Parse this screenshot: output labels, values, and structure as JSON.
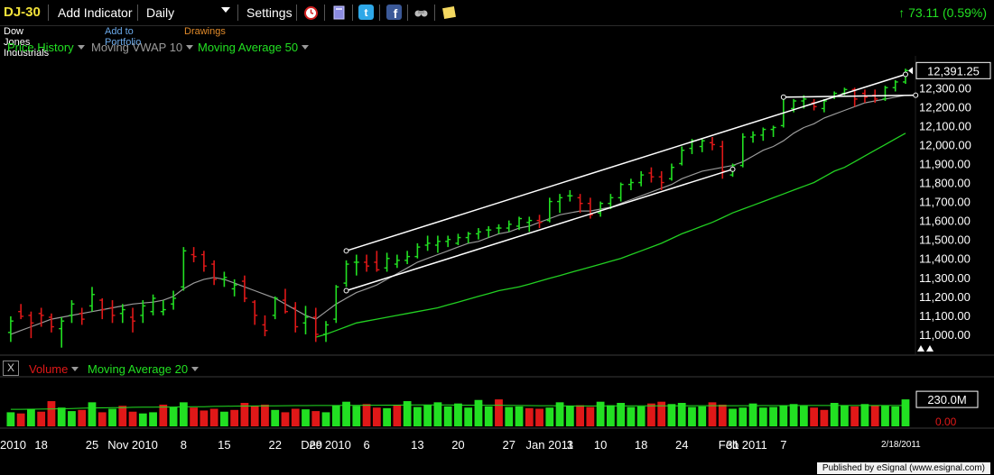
{
  "toolbar": {
    "symbol": "DJ-30",
    "add_indicator": "Add Indicator",
    "timeframe": "Daily",
    "settings": "Settings",
    "change": "73.11 (0.59%)",
    "icons": [
      "alarm-clock-icon",
      "book-icon",
      "twitter-icon",
      "facebook-icon",
      "binoculars-icon",
      "note-icon"
    ]
  },
  "links": {
    "name": "Dow Jones Industrials",
    "portfolio": "Add to Portfolio",
    "drawings": "Drawings"
  },
  "studies": {
    "price_history": "Price History",
    "vwap": "Moving VWAP 10",
    "ma50": "Moving Average 50"
  },
  "volume_pane": {
    "close_label": "X",
    "volume": "Volume",
    "ma20": "Moving Average 20",
    "last_value": "230.0M",
    "zero_label": "0.00"
  },
  "last_price": "12,391.25",
  "date_stamp": "2/18/2011",
  "footer": "Published by eSignal (www.esignal.com)",
  "colors": {
    "up": "#22e022",
    "down": "#e01818",
    "vwap": "#9a9a9a",
    "ma50": "#22d022",
    "background": "#000000"
  },
  "chart_data": {
    "type": "bar",
    "ylim": [
      10900,
      12420
    ],
    "yticks": [
      "12,300.00",
      "12,200.00",
      "12,100.00",
      "12,000.00",
      "11,900.00",
      "11,800.00",
      "11,700.00",
      "11,600.00",
      "11,500.00",
      "11,400.00",
      "11,300.00",
      "11,200.00",
      "11,100.00",
      "11,000.00"
    ],
    "ytick_values": [
      12300,
      12200,
      12100,
      12000,
      11900,
      11800,
      11700,
      11600,
      11500,
      11400,
      11300,
      11200,
      11100,
      11000
    ],
    "x_labels": [
      "2010",
      "18",
      "25",
      "Nov 2010",
      "8",
      "15",
      "22",
      "29",
      "Dec 2010",
      "6",
      "13",
      "20",
      "27",
      "Jan 2011",
      "3",
      "10",
      "18",
      "24",
      "31",
      "Feb 2011",
      "7"
    ],
    "x_label_index": [
      -1,
      3,
      8,
      12,
      17,
      21,
      26,
      30,
      31,
      35,
      40,
      44,
      49,
      53,
      53,
      58,
      62,
      66,
      71,
      72,
      76
    ],
    "ohlc": [
      [
        11010,
        11095,
        10960,
        11070
      ],
      [
        11120,
        11160,
        11080,
        11095
      ],
      [
        11100,
        11120,
        10980,
        11060
      ],
      [
        11110,
        11140,
        11040,
        11100
      ],
      [
        11090,
        11110,
        11010,
        11040
      ],
      [
        11030,
        11090,
        10930,
        11070
      ],
      [
        11100,
        11180,
        11060,
        11160
      ],
      [
        11110,
        11140,
        11050,
        11080
      ],
      [
        11150,
        11250,
        11120,
        11210
      ],
      [
        11180,
        11190,
        11080,
        11130
      ],
      [
        11140,
        11180,
        11060,
        11100
      ],
      [
        11110,
        11160,
        11060,
        11130
      ],
      [
        11090,
        11140,
        11010,
        11070
      ],
      [
        11100,
        11180,
        11060,
        11150
      ],
      [
        11120,
        11210,
        11100,
        11190
      ],
      [
        11120,
        11180,
        11100,
        11130
      ],
      [
        11160,
        11230,
        11130,
        11190
      ],
      [
        11250,
        11460,
        11230,
        11440
      ],
      [
        11420,
        11460,
        11380,
        11410
      ],
      [
        11420,
        11440,
        11330,
        11360
      ],
      [
        11370,
        11390,
        11260,
        11290
      ],
      [
        11290,
        11330,
        11250,
        11300
      ],
      [
        11240,
        11290,
        11200,
        11260
      ],
      [
        11280,
        11310,
        11170,
        11190
      ],
      [
        11170,
        11180,
        11050,
        11100
      ],
      [
        11050,
        11100,
        10990,
        11020
      ],
      [
        11100,
        11200,
        11080,
        11190
      ],
      [
        11180,
        11240,
        11110,
        11120
      ],
      [
        11140,
        11170,
        11010,
        11040
      ],
      [
        11060,
        11150,
        11000,
        11090
      ],
      [
        11090,
        11140,
        10960,
        11000
      ],
      [
        11000,
        11070,
        10960,
        11050
      ],
      [
        11080,
        11260,
        11060,
        11250
      ],
      [
        11270,
        11390,
        11250,
        11370
      ],
      [
        11380,
        11420,
        11310,
        11380
      ],
      [
        11380,
        11420,
        11330,
        11360
      ],
      [
        11380,
        11440,
        11330,
        11340
      ],
      [
        11350,
        11430,
        11330,
        11400
      ],
      [
        11370,
        11420,
        11350,
        11390
      ],
      [
        11390,
        11440,
        11370,
        11410
      ],
      [
        11410,
        11480,
        11400,
        11460
      ],
      [
        11470,
        11520,
        11440,
        11480
      ],
      [
        11470,
        11520,
        11430,
        11490
      ],
      [
        11490,
        11520,
        11460,
        11500
      ],
      [
        11480,
        11530,
        11470,
        11510
      ],
      [
        11510,
        11540,
        11480,
        11530
      ],
      [
        11530,
        11560,
        11500,
        11540
      ],
      [
        11550,
        11570,
        11510,
        11550
      ],
      [
        11560,
        11580,
        11530,
        11560
      ],
      [
        11560,
        11600,
        11540,
        11580
      ],
      [
        11570,
        11620,
        11550,
        11610
      ],
      [
        11590,
        11620,
        11540,
        11600
      ],
      [
        11600,
        11630,
        11560,
        11590
      ],
      [
        11600,
        11720,
        11590,
        11700
      ],
      [
        11700,
        11740,
        11640,
        11720
      ],
      [
        11730,
        11760,
        11700,
        11730
      ],
      [
        11720,
        11740,
        11640,
        11690
      ],
      [
        11690,
        11720,
        11610,
        11630
      ],
      [
        11640,
        11700,
        11620,
        11690
      ],
      [
        11690,
        11740,
        11660,
        11720
      ],
      [
        11720,
        11800,
        11700,
        11790
      ],
      [
        11790,
        11820,
        11760,
        11800
      ],
      [
        11800,
        11860,
        11780,
        11840
      ],
      [
        11850,
        11880,
        11800,
        11830
      ],
      [
        11830,
        11860,
        11760,
        11800
      ],
      [
        11820,
        11900,
        11810,
        11880
      ],
      [
        11900,
        11990,
        11890,
        11970
      ],
      [
        11980,
        12030,
        11950,
        12020
      ],
      [
        11990,
        12030,
        11960,
        12020
      ],
      [
        12010,
        12040,
        11970,
        12000
      ],
      [
        11990,
        12020,
        11820,
        11860
      ],
      [
        11840,
        11900,
        11830,
        11890
      ],
      [
        11890,
        12060,
        11880,
        12040
      ],
      [
        12040,
        12070,
        12010,
        12050
      ],
      [
        12050,
        12090,
        12020,
        12080
      ],
      [
        12080,
        12100,
        12040,
        12090
      ],
      [
        12100,
        12250,
        12090,
        12170
      ],
      [
        12190,
        12240,
        12170,
        12230
      ],
      [
        12230,
        12260,
        12190,
        12240
      ],
      [
        12220,
        12240,
        12180,
        12200
      ],
      [
        12190,
        12240,
        12170,
        12230
      ],
      [
        12250,
        12280,
        12240,
        12270
      ],
      [
        12270,
        12300,
        12260,
        12290
      ],
      [
        12290,
        12300,
        12200,
        12240
      ],
      [
        12270,
        12290,
        12220,
        12250
      ],
      [
        12260,
        12290,
        12220,
        12240
      ],
      [
        12240,
        12310,
        12230,
        12300
      ],
      [
        12300,
        12340,
        12280,
        12330
      ],
      [
        12330,
        12400,
        12320,
        12390
      ]
    ],
    "vwap": [
      11000,
      11020,
      11040,
      11060,
      11080,
      11090,
      11100,
      11110,
      11120,
      11130,
      11140,
      11150,
      11160,
      11165,
      11170,
      11180,
      11200,
      11240,
      11270,
      11290,
      11300,
      11290,
      11270,
      11250,
      11230,
      11210,
      11190,
      11160,
      11130,
      11100,
      11080,
      11120,
      11160,
      11190,
      11220,
      11240,
      11260,
      11290,
      11320,
      11350,
      11380,
      11400,
      11420,
      11440,
      11460,
      11480,
      11490,
      11510,
      11530,
      11540,
      11560,
      11570,
      11590,
      11610,
      11630,
      11640,
      11650,
      11650,
      11660,
      11670,
      11690,
      11710,
      11730,
      11750,
      11770,
      11790,
      11820,
      11840,
      11860,
      11870,
      11880,
      11890,
      11910,
      11940,
      11970,
      11990,
      12020,
      12060,
      12090,
      12110,
      12140,
      12160,
      12180,
      12200,
      12220,
      12230,
      12240,
      12250,
      12260
    ],
    "ma50_start_index": 30,
    "ma50": [
      10985,
      11000,
      11020,
      11040,
      11060,
      11070,
      11080,
      11090,
      11100,
      11110,
      11120,
      11130,
      11140,
      11155,
      11170,
      11185,
      11200,
      11215,
      11230,
      11240,
      11250,
      11265,
      11280,
      11295,
      11310,
      11325,
      11340,
      11355,
      11370,
      11385,
      11400,
      11420,
      11440,
      11460,
      11480,
      11505,
      11530,
      11550,
      11570,
      11590,
      11615,
      11640,
      11660,
      11680,
      11700,
      11720,
      11740,
      11760,
      11780,
      11800,
      11830,
      11860,
      11880,
      11910,
      11940,
      11970,
      12000,
      12030,
      12060
    ],
    "channels": [
      {
        "from": [
          33,
          11440
        ],
        "to": [
          88,
          12370
        ]
      },
      {
        "from": [
          33,
          11230
        ],
        "to": [
          71,
          11870
        ]
      },
      {
        "from": [
          76,
          12250
        ],
        "to": [
          89,
          12260
        ]
      }
    ],
    "volume": {
      "ylim": [
        0,
        300
      ],
      "values": [
        120,
        110,
        150,
        125,
        215,
        160,
        130,
        140,
        205,
        120,
        150,
        175,
        125,
        110,
        120,
        185,
        165,
        205,
        160,
        135,
        150,
        125,
        140,
        200,
        175,
        185,
        140,
        120,
        150,
        145,
        130,
        120,
        180,
        210,
        175,
        190,
        160,
        155,
        185,
        215,
        165,
        180,
        205,
        170,
        195,
        160,
        225,
        170,
        230,
        165,
        170,
        155,
        150,
        160,
        205,
        175,
        180,
        165,
        210,
        180,
        200,
        165,
        170,
        195,
        210,
        190,
        200,
        165,
        170,
        205,
        185,
        150,
        160,
        195,
        160,
        165,
        180,
        190,
        175,
        160,
        140,
        200,
        180,
        170,
        190,
        180,
        175,
        170,
        230
      ],
      "up": [
        1,
        0,
        1,
        0,
        0,
        1,
        1,
        0,
        1,
        0,
        1,
        0,
        0,
        1,
        1,
        0,
        1,
        1,
        0,
        0,
        0,
        1,
        0,
        0,
        0,
        0,
        1,
        0,
        0,
        1,
        0,
        1,
        1,
        1,
        1,
        0,
        0,
        1,
        0,
        1,
        1,
        1,
        1,
        1,
        1,
        1,
        1,
        1,
        0,
        1,
        1,
        0,
        0,
        1,
        1,
        1,
        0,
        0,
        1,
        1,
        1,
        1,
        1,
        0,
        0,
        1,
        1,
        1,
        1,
        0,
        0,
        1,
        1,
        1,
        1,
        1,
        1,
        1,
        1,
        0,
        0,
        1,
        1,
        0,
        1,
        0,
        1,
        1,
        1
      ],
      "ma20": [
        145,
        145,
        146,
        147,
        148,
        150,
        152,
        155,
        157,
        158,
        159,
        160,
        162,
        163,
        164,
        165,
        165,
        166,
        167,
        168,
        170,
        171,
        172,
        173,
        174,
        175,
        175,
        176,
        177,
        177,
        178,
        178,
        178,
        179,
        179,
        180,
        180,
        181,
        181,
        182,
        182,
        182,
        182,
        182,
        181,
        181,
        180,
        180,
        180,
        179,
        178,
        177,
        176,
        176,
        175,
        174,
        174,
        174,
        174,
        174,
        174,
        175,
        175,
        175,
        175,
        175,
        175,
        176,
        176,
        176,
        176,
        176,
        176,
        176,
        177,
        177,
        177,
        177,
        178,
        178,
        178,
        178,
        178,
        178,
        178,
        178,
        178,
        178,
        178
      ]
    }
  }
}
